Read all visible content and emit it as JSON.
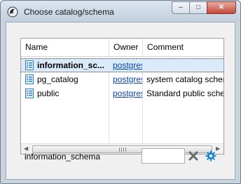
{
  "window": {
    "title": "Choose catalog/schema",
    "buttons": {
      "minimize": "–",
      "maximize": "□",
      "close": "✕"
    }
  },
  "table": {
    "columns": [
      "Name",
      "Owner",
      "Comment"
    ],
    "rows": [
      {
        "name": "information_sc...",
        "owner": "postgres",
        "comment": "",
        "selected": true
      },
      {
        "name": "pg_catalog",
        "owner": "postgres",
        "comment": "system catalog schema",
        "selected": false
      },
      {
        "name": "public",
        "owner": "postgres",
        "comment": "Standard public schema",
        "selected": false
      }
    ],
    "scrollbar": {
      "left_arrow": "◀",
      "right_arrow": "▶"
    }
  },
  "footer": {
    "selected_label": "information_schema",
    "filter_value": ""
  },
  "colors": {
    "link": "#0645ad",
    "selection": "#dbeaf9",
    "accent_icon": "#1e88d6"
  },
  "icons": [
    "app-icon",
    "schema-icon",
    "clear-icon",
    "gear-icon"
  ]
}
